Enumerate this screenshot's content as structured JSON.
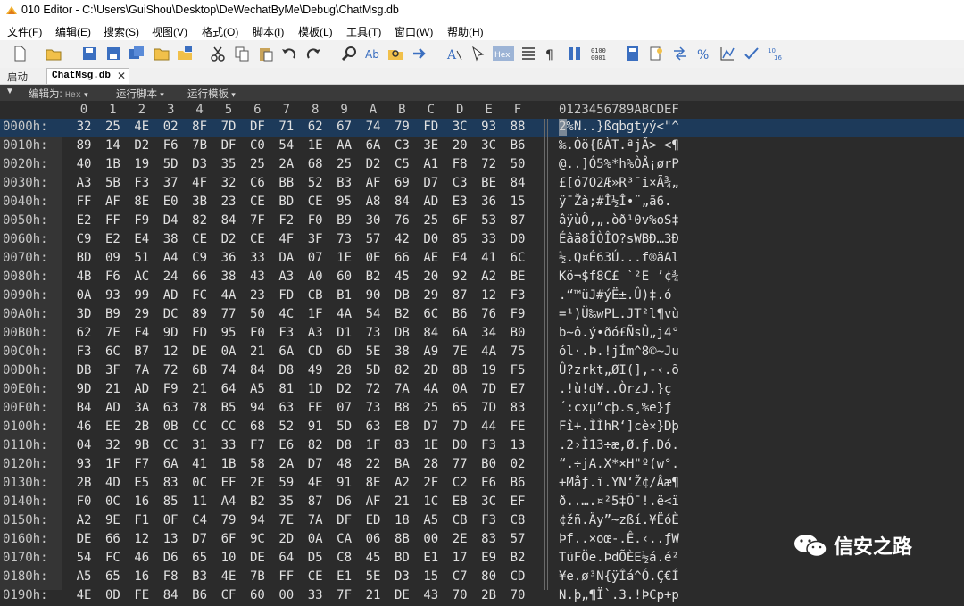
{
  "window": {
    "title": "010 Editor - C:\\Users\\GuiShou\\Desktop\\DeWechatByMe\\Debug\\ChatMsg.db"
  },
  "menu": [
    "文件(F)",
    "编辑(E)",
    "搜索(S)",
    "视图(V)",
    "格式(O)",
    "脚本(I)",
    "模板(L)",
    "工具(T)",
    "窗口(W)",
    "帮助(H)"
  ],
  "tabs": {
    "start": "启动",
    "active": "ChatMsg.db"
  },
  "subbar": {
    "edit_as_label": "编辑为:",
    "edit_as_value": "Hex",
    "run_script": "运行脚本",
    "run_template": "运行模板"
  },
  "hex_header": {
    "columns": [
      "0",
      "1",
      "2",
      "3",
      "4",
      "5",
      "6",
      "7",
      "8",
      "9",
      "A",
      "B",
      "C",
      "D",
      "E",
      "F"
    ],
    "ascii": "0123456789ABCDEF"
  },
  "rows": [
    {
      "addr": "0000h:",
      "hex": [
        "32",
        "25",
        "4E",
        "02",
        "8F",
        "7D",
        "DF",
        "71",
        "62",
        "67",
        "74",
        "79",
        "FD",
        "3C",
        "93",
        "88"
      ],
      "ascii": "2%N..}ßqbgtyý<\"^"
    },
    {
      "addr": "0010h:",
      "hex": [
        "89",
        "14",
        "D2",
        "F6",
        "7B",
        "DF",
        "C0",
        "54",
        "1E",
        "AA",
        "6A",
        "C3",
        "3E",
        "20",
        "3C",
        "B6"
      ],
      "ascii": "‰.Òö{ßÀT.ªjÃ> <¶"
    },
    {
      "addr": "0020h:",
      "hex": [
        "40",
        "1B",
        "19",
        "5D",
        "D3",
        "35",
        "25",
        "2A",
        "68",
        "25",
        "D2",
        "C5",
        "A1",
        "F8",
        "72",
        "50"
      ],
      "ascii": "@..]Ó5%*h%ÒÅ¡ørP"
    },
    {
      "addr": "0030h:",
      "hex": [
        "A3",
        "5B",
        "F3",
        "37",
        "4F",
        "32",
        "C6",
        "BB",
        "52",
        "B3",
        "AF",
        "69",
        "D7",
        "C3",
        "BE",
        "84"
      ],
      "ascii": "£[ó7O2Æ»R³¯i×Ã¾„"
    },
    {
      "addr": "0040h:",
      "hex": [
        "FF",
        "AF",
        "8E",
        "E0",
        "3B",
        "23",
        "CE",
        "BD",
        "CE",
        "95",
        "A8",
        "84",
        "AD",
        "E3",
        "36",
        "15"
      ],
      "ascii": "ÿ¯Žà;#Î½Î•¨„­ã6."
    },
    {
      "addr": "0050h:",
      "hex": [
        "E2",
        "FF",
        "F9",
        "D4",
        "82",
        "84",
        "7F",
        "F2",
        "F0",
        "B9",
        "30",
        "76",
        "25",
        "6F",
        "53",
        "87"
      ],
      "ascii": "âÿùÔ‚„.òð¹0v%oS‡"
    },
    {
      "addr": "0060h:",
      "hex": [
        "C9",
        "E2",
        "E4",
        "38",
        "CE",
        "D2",
        "CE",
        "4F",
        "3F",
        "73",
        "57",
        "42",
        "D0",
        "85",
        "33",
        "D0"
      ],
      "ascii": "Éâä8ÎÒÎO?sWBÐ…3Ð"
    },
    {
      "addr": "0070h:",
      "hex": [
        "BD",
        "09",
        "51",
        "A4",
        "C9",
        "36",
        "33",
        "DA",
        "07",
        "1E",
        "0E",
        "66",
        "AE",
        "E4",
        "41",
        "6C"
      ],
      "ascii": "½.Q¤É63Ú...f®äAl"
    },
    {
      "addr": "0080h:",
      "hex": [
        "4B",
        "F6",
        "AC",
        "24",
        "66",
        "38",
        "43",
        "A3",
        "A0",
        "60",
        "B2",
        "45",
        "20",
        "92",
        "A2",
        "BE"
      ],
      "ascii": "Kö¬$f8C£ `²E ’¢¾"
    },
    {
      "addr": "0090h:",
      "hex": [
        "0A",
        "93",
        "99",
        "AD",
        "FC",
        "4A",
        "23",
        "FD",
        "CB",
        "B1",
        "90",
        "DB",
        "29",
        "87",
        "12",
        "F3"
      ],
      "ascii": ".“™­üJ#ýË±.Û)‡.ó"
    },
    {
      "addr": "00A0h:",
      "hex": [
        "3D",
        "B9",
        "29",
        "DC",
        "89",
        "77",
        "50",
        "4C",
        "1F",
        "4A",
        "54",
        "B2",
        "6C",
        "B6",
        "76",
        "F9"
      ],
      "ascii": "=¹)Ü‰wPL.JT²l¶vù"
    },
    {
      "addr": "00B0h:",
      "hex": [
        "62",
        "7E",
        "F4",
        "9D",
        "FD",
        "95",
        "F0",
        "F3",
        "A3",
        "D1",
        "73",
        "DB",
        "84",
        "6A",
        "34",
        "B0"
      ],
      "ascii": "b~ô.ý•ðó£ÑsÛ„j4°"
    },
    {
      "addr": "00C0h:",
      "hex": [
        "F3",
        "6C",
        "B7",
        "12",
        "DE",
        "0A",
        "21",
        "6A",
        "CD",
        "6D",
        "5E",
        "38",
        "A9",
        "7E",
        "4A",
        "75"
      ],
      "ascii": "ól·.Þ.!jÍm^8©~Ju"
    },
    {
      "addr": "00D0h:",
      "hex": [
        "DB",
        "3F",
        "7A",
        "72",
        "6B",
        "74",
        "84",
        "D8",
        "49",
        "28",
        "5D",
        "82",
        "2D",
        "8B",
        "19",
        "F5"
      ],
      "ascii": "Û?zrkt„ØI(]‚-‹.õ"
    },
    {
      "addr": "00E0h:",
      "hex": [
        "9D",
        "21",
        "AD",
        "F9",
        "21",
        "64",
        "A5",
        "81",
        "1D",
        "D2",
        "72",
        "7A",
        "4A",
        "0A",
        "7D",
        "E7"
      ],
      "ascii": ".!­ù!d¥..ÒrzJ.}ç"
    },
    {
      "addr": "00F0h:",
      "hex": [
        "B4",
        "AD",
        "3A",
        "63",
        "78",
        "B5",
        "94",
        "63",
        "FE",
        "07",
        "73",
        "B8",
        "25",
        "65",
        "7D",
        "83"
      ],
      "ascii": "´­:cxµ”cþ.s¸%e}ƒ"
    },
    {
      "addr": "0100h:",
      "hex": [
        "46",
        "EE",
        "2B",
        "0B",
        "CC",
        "CC",
        "68",
        "52",
        "91",
        "5D",
        "63",
        "E8",
        "D7",
        "7D",
        "44",
        "FE"
      ],
      "ascii": "Fî+.ÌÌhR‘]cè×}Dþ"
    },
    {
      "addr": "0110h:",
      "hex": [
        "04",
        "32",
        "9B",
        "CC",
        "31",
        "33",
        "F7",
        "E6",
        "82",
        "D8",
        "1F",
        "83",
        "1E",
        "D0",
        "F3",
        "13"
      ],
      "ascii": ".2›Ì13÷æ‚Ø.ƒ.Ðó."
    },
    {
      "addr": "0120h:",
      "hex": [
        "93",
        "1F",
        "F7",
        "6A",
        "41",
        "1B",
        "58",
        "2A",
        "D7",
        "48",
        "22",
        "BA",
        "28",
        "77",
        "B0",
        "02"
      ],
      "ascii": "“.÷jA.X*×H\"º(w°."
    },
    {
      "addr": "0130h:",
      "hex": [
        "2B",
        "4D",
        "E5",
        "83",
        "0C",
        "EF",
        "2E",
        "59",
        "4E",
        "91",
        "8E",
        "A2",
        "2F",
        "C2",
        "E6",
        "B6"
      ],
      "ascii": "+Måƒ.ï.YN‘Ž¢/Âæ¶"
    },
    {
      "addr": "0140h:",
      "hex": [
        "F0",
        "0C",
        "16",
        "85",
        "11",
        "A4",
        "B2",
        "35",
        "87",
        "D6",
        "AF",
        "21",
        "1C",
        "EB",
        "3C",
        "EF"
      ],
      "ascii": "ð..….¤²5‡Ö¯!.ë<ï"
    },
    {
      "addr": "0150h:",
      "hex": [
        "A2",
        "9E",
        "F1",
        "0F",
        "C4",
        "79",
        "94",
        "7E",
        "7A",
        "DF",
        "ED",
        "18",
        "A5",
        "CB",
        "F3",
        "C8"
      ],
      "ascii": "¢žñ.Äy”~zßí.¥ËóÈ"
    },
    {
      "addr": "0160h:",
      "hex": [
        "DE",
        "66",
        "12",
        "13",
        "D7",
        "6F",
        "9C",
        "2D",
        "0A",
        "CA",
        "06",
        "8B",
        "00",
        "2E",
        "83",
        "57"
      ],
      "ascii": "Þf..×oœ-.Ê.‹..ƒW"
    },
    {
      "addr": "0170h:",
      "hex": [
        "54",
        "FC",
        "46",
        "D6",
        "65",
        "10",
        "DE",
        "64",
        "D5",
        "C8",
        "45",
        "BD",
        "E1",
        "17",
        "E9",
        "B2"
      ],
      "ascii": "TüFÖe.ÞdÕÈE½á.é²"
    },
    {
      "addr": "0180h:",
      "hex": [
        "A5",
        "65",
        "16",
        "F8",
        "B3",
        "4E",
        "7B",
        "FF",
        "CE",
        "E1",
        "5E",
        "D3",
        "15",
        "C7",
        "80",
        "CD"
      ],
      "ascii": "¥e.ø³N{ÿÎá^Ó.Ç€Í"
    },
    {
      "addr": "0190h:",
      "hex": [
        "4E",
        "0D",
        "FE",
        "84",
        "B6",
        "CF",
        "60",
        "00",
        "33",
        "7F",
        "21",
        "DE",
        "43",
        "70",
        "2B",
        "70"
      ],
      "ascii": "N.þ„¶Ï`.3.!ÞCp+p"
    }
  ],
  "watermark": {
    "text": "信安之路"
  }
}
